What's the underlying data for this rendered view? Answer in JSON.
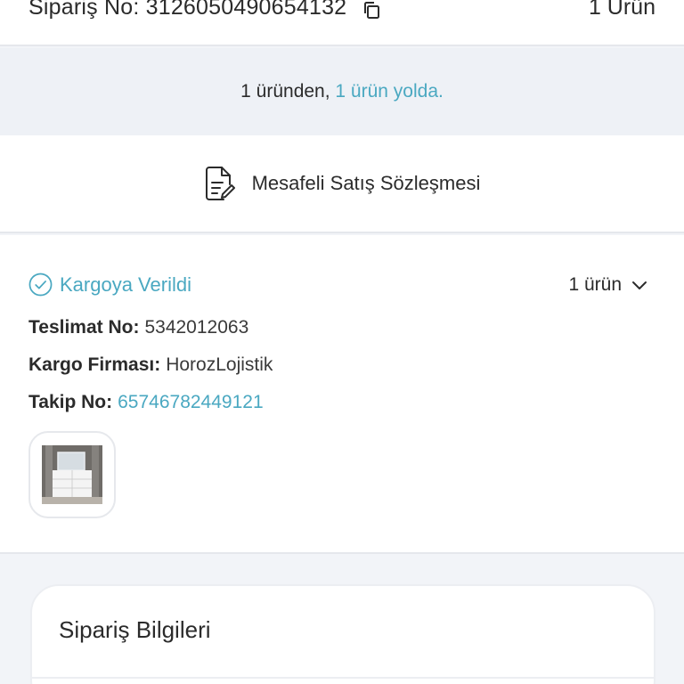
{
  "header": {
    "order_no": "Sipariş No: 3126050490654132",
    "item_count": "1 Ürün"
  },
  "progress": {
    "prefix": "1 üründen, ",
    "highlight": "1 ürün yolda."
  },
  "contract": {
    "label": "Mesafeli Satış Sözleşmesi"
  },
  "shipment": {
    "status": "Kargoya Verildi",
    "count": "1 ürün",
    "delivery_key": "Teslimat No:",
    "delivery_value": "5342012063",
    "carrier_key": "Kargo Firması:",
    "carrier_value": "HorozLojistik",
    "tracking_key": "Takip No:",
    "tracking_value": "65746782449121"
  },
  "info_card": {
    "title": "Sipariş Bilgileri"
  },
  "colors": {
    "accent": "#4aa8c1",
    "text": "#2b2b2b",
    "band": "#eef1f6"
  },
  "icons": {
    "copy": "copy-icon",
    "contract": "document-edit-icon",
    "status": "check-circle-icon",
    "toggle": "chevron-down-icon"
  }
}
